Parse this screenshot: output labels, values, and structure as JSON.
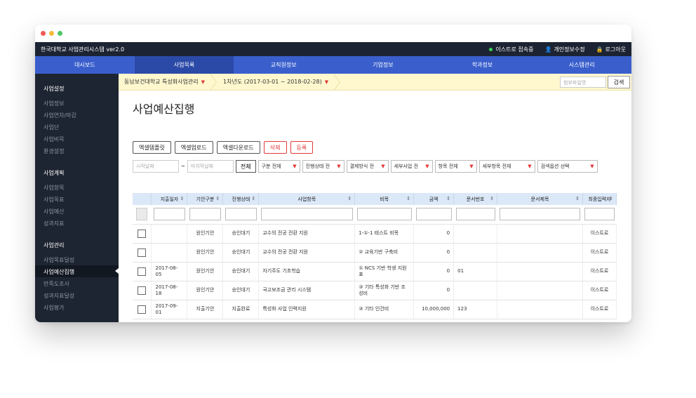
{
  "app": {
    "title": "한국대학교 사업관리시스템 ver2.0",
    "user_status": "이스트로 접속중",
    "profile_edit": "개인정보수정",
    "logout": "로그아웃"
  },
  "nav": {
    "tabs": [
      {
        "label": "대시보드"
      },
      {
        "label": "사업목록"
      },
      {
        "label": "교직원정보"
      },
      {
        "label": "기업정보"
      },
      {
        "label": "학과정보"
      },
      {
        "label": "시스템관리"
      }
    ],
    "active_index": 1
  },
  "sidebar": {
    "groups": [
      {
        "title": "사업설정",
        "items": [
          "사업정보",
          "사업연차/마감",
          "사업단",
          "사업비목",
          "환경설정"
        ]
      },
      {
        "title": "사업계획",
        "items": [
          "사업항목",
          "사업목표",
          "사업예산",
          "성과지표"
        ]
      },
      {
        "title": "사업관리",
        "items": [
          "사업목표달성",
          "사업예산집행",
          "만족도조사",
          "성과지표달성",
          "사업평가"
        ]
      }
    ],
    "active_item": "사업예산집행"
  },
  "breadcrumb": {
    "project": "동남보건대학교 특성화사업관리",
    "period": "1차년도 (2017-03-01 ~ 2018-02-28)",
    "search_placeholder": "첨부파일명",
    "search_button": "검색"
  },
  "page": {
    "title": "사업예산집행"
  },
  "actions": {
    "excel_template": "엑셀템플릿",
    "excel_upload": "엑셀업로드",
    "excel_download": "엑셀다운로드",
    "delete": "삭제",
    "register": "등록"
  },
  "filters": {
    "start_date_placeholder": "시작날짜",
    "tilde": "~",
    "end_date_placeholder": "마지막날짜",
    "all_button": "전체",
    "selects": [
      "구분 전체",
      "진행상태 전",
      "결제방식 전",
      "세부사업 전",
      "항목 전체",
      "세부항목 전체",
      "검색옵션 선택"
    ]
  },
  "table": {
    "columns": [
      "",
      "지출일자",
      "기안구분",
      "진행상태",
      "사업항목",
      "비목",
      "금액",
      "문서번호",
      "문서제목",
      "최종입력자"
    ],
    "rows": [
      [
        "",
        "",
        "원인기안",
        "승인대기",
        "교수의 전공 전환 지원",
        "1-①-1 테스트 비목",
        "0",
        "",
        "",
        "이스트로"
      ],
      [
        "",
        "",
        "원인기안",
        "승인대기",
        "교수의 전공 전환 지원",
        "② 교육기반 구축비",
        "0",
        "",
        "",
        "이스트로"
      ],
      [
        "",
        "2017-08-05",
        "원인기안",
        "승인대기",
        "자기주도 기초학습",
        "① NCS 기반 학생 지원 표",
        "0",
        "01",
        "",
        "이스트로"
      ],
      [
        "",
        "2017-08-18",
        "원인기안",
        "승인대기",
        "국고보조금 관리 시스템",
        "③ 기타 특성화 기반 조성비",
        "0",
        "",
        "",
        "이스트로"
      ],
      [
        "",
        "2017-09-01",
        "지출기안",
        "지출완료",
        "특성화 사업 인력지원",
        "③ 기타 인건비",
        "10,000,000",
        "123",
        "",
        "이스트로"
      ]
    ]
  },
  "colors": {
    "nav_bg": "#3a5fcd",
    "topbar_bg": "#1c2433",
    "sidebar_bg": "#1e2532",
    "accent_red": "#e23b3b",
    "breadcrumb_bg": "#fff8cf",
    "table_header_bg": "#dbe8f8"
  }
}
